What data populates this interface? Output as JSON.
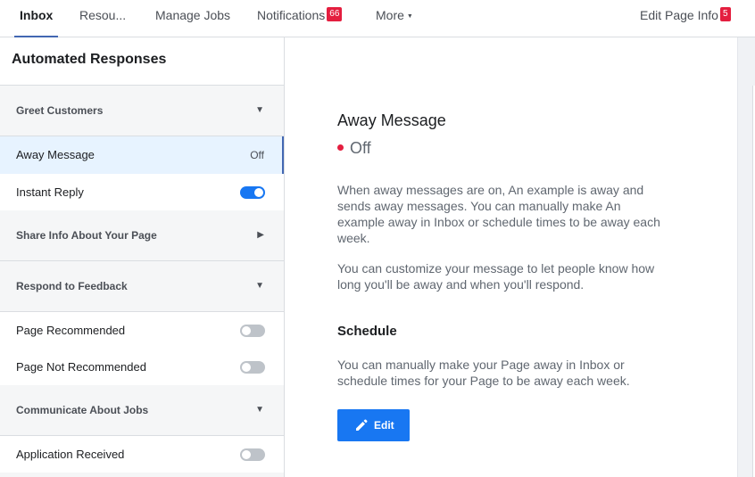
{
  "nav": {
    "tabs": [
      {
        "label": "Inbox"
      },
      {
        "label": "Resou..."
      },
      {
        "label": "Manage Jobs"
      },
      {
        "label": "Notifications",
        "badge": "66"
      },
      {
        "label": "More"
      }
    ],
    "edit_page_info": {
      "label": "Edit Page Info",
      "badge": "5"
    }
  },
  "sidebar": {
    "title": "Automated Responses",
    "sections": [
      {
        "label": "Greet Customers",
        "expanded": true
      },
      {
        "label": "Share Info About Your Page",
        "expanded": false
      },
      {
        "label": "Respond to Feedback",
        "expanded": true
      },
      {
        "label": "Communicate About Jobs",
        "expanded": true
      }
    ],
    "items": {
      "away_message": {
        "label": "Away Message",
        "state": "Off"
      },
      "instant_reply": {
        "label": "Instant Reply",
        "on": true
      },
      "page_recommended": {
        "label": "Page Recommended",
        "on": false
      },
      "page_not_recommended": {
        "label": "Page Not Recommended",
        "on": false
      },
      "application_received": {
        "label": "Application Received",
        "on": false
      }
    }
  },
  "main": {
    "heading": "Away Message",
    "status": "Off",
    "description_1": "When away messages are on, An example is away and sends away messages. You can manually make An example away in Inbox or schedule times to be away each week.",
    "description_2": "You can customize your message to let people know how long you'll be away and when you'll respond.",
    "schedule_heading": "Schedule",
    "schedule_text": "You can manually make your Page away in Inbox or schedule times for your Page to be away each week.",
    "edit_label": "Edit"
  },
  "colors": {
    "accent": "#4267b2",
    "button": "#1877f2",
    "badge": "#e41e3f",
    "status_off": "#e41e3f"
  },
  "icons": {
    "edit": "pencil-icon",
    "section_expanded": "caret-down-icon",
    "section_collapsed": "caret-right-icon",
    "more": "caret-down-icon"
  }
}
